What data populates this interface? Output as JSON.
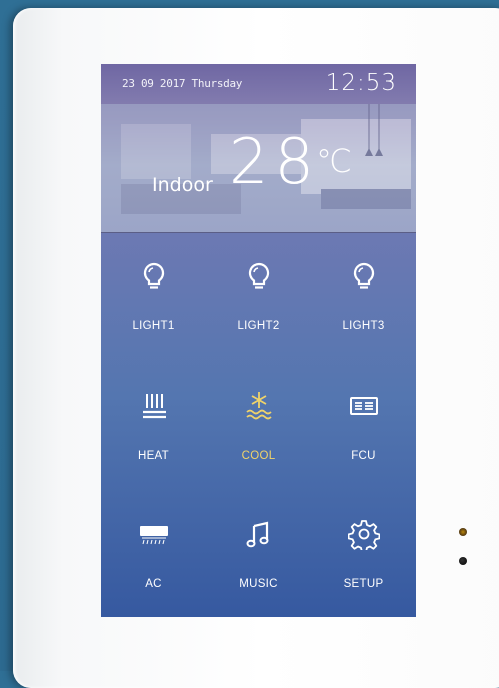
{
  "screen": {
    "date": "23 09 2017 Thursday",
    "time": "12:53",
    "temperature": {
      "label": "Indoor",
      "value": "28",
      "unit": "℃"
    }
  },
  "tiles": [
    {
      "label": "LIGHT1",
      "icon": "light-bulb-icon",
      "active": false
    },
    {
      "label": "LIGHT2",
      "icon": "light-bulb-icon",
      "active": false
    },
    {
      "label": "LIGHT3",
      "icon": "light-bulb-icon",
      "active": false
    },
    {
      "label": "HEAT",
      "icon": "heat-icon",
      "active": false
    },
    {
      "label": "COOL",
      "icon": "cool-icon",
      "active": true
    },
    {
      "label": "FCU",
      "icon": "fcu-icon",
      "active": false
    },
    {
      "label": "AC",
      "icon": "air-conditioner-icon",
      "active": false
    },
    {
      "label": "MUSIC",
      "icon": "music-note-icon",
      "active": false
    },
    {
      "label": "SETUP",
      "icon": "gear-icon",
      "active": false
    }
  ],
  "colors": {
    "active": "#f0d36a",
    "text": "#ffffff",
    "wall": "#2f6f95",
    "panel": "#ffffff"
  }
}
